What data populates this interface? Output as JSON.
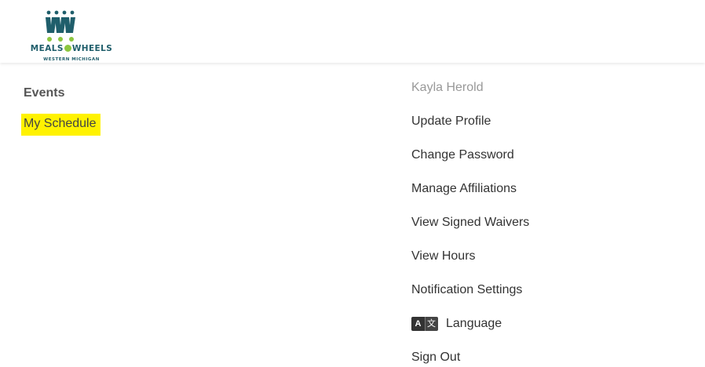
{
  "brand": {
    "name_left": "MEALS",
    "name_right": "WHEELS",
    "tagline": "WESTERN MICHIGAN",
    "colors": {
      "primary": "#1f5e6b",
      "accent": "#8cc63f",
      "highlight": "#fff200"
    }
  },
  "left_nav": {
    "heading": "Events",
    "items": [
      {
        "label": "My Schedule",
        "highlighted": true
      }
    ]
  },
  "user_menu": {
    "user_name": "Kayla Herold",
    "items": [
      {
        "label": "Update Profile"
      },
      {
        "label": "Change Password"
      },
      {
        "label": "Manage Affiliations"
      },
      {
        "label": "View Signed Waivers"
      },
      {
        "label": "View Hours"
      },
      {
        "label": "Notification Settings"
      },
      {
        "label": "Language",
        "icon": "translate-icon",
        "icon_glyph_left": "A",
        "icon_glyph_right": "文"
      },
      {
        "label": "Sign Out"
      }
    ]
  }
}
